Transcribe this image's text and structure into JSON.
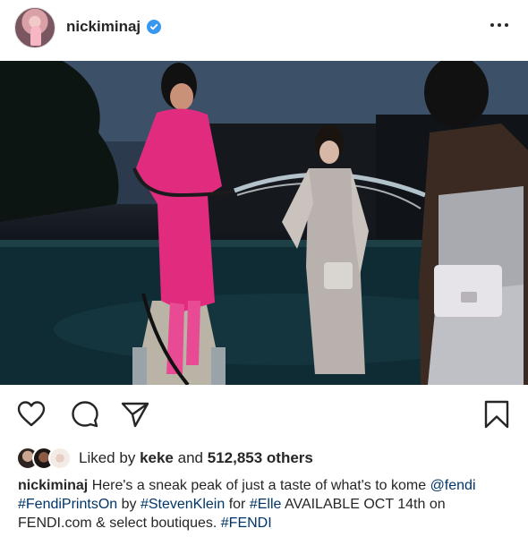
{
  "post": {
    "username": "nickiminaj",
    "likes": {
      "prefix": "Liked by",
      "liker": "keke",
      "and": "and",
      "count": "512,853",
      "suffix": "others"
    },
    "caption": {
      "username": "nickiminaj",
      "text1": " Here's a sneak peak of just a taste of what's to kome ",
      "mention_fendi": "@fendi",
      "tag_fendiprints": "#FendiPrintsOn",
      "by": " by ",
      "tag_stevenklein": "#StevenKlein",
      "for": " for ",
      "tag_elle": "#Elle",
      "text2": " AVAILABLE OCT 14th on FENDI.com & select boutiques. ",
      "tag_fendi": "#FENDI"
    }
  },
  "colors": {
    "verified": "#3897f0",
    "hashtag": "#003569",
    "text": "#262626"
  },
  "icons": {
    "verified": "verified-badge-icon",
    "more": "more-options-icon",
    "like": "heart-icon",
    "comment": "comment-icon",
    "share": "paper-plane-icon",
    "save": "bookmark-icon"
  }
}
